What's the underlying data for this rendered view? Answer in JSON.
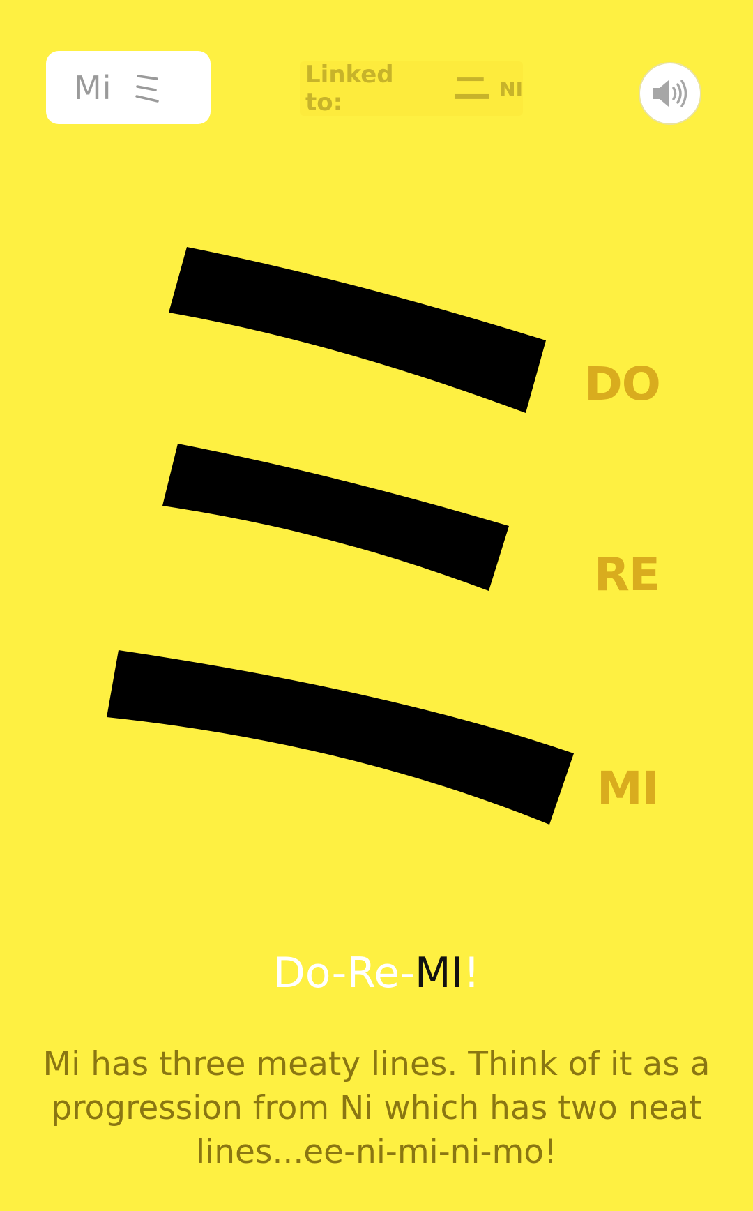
{
  "header": {
    "kana_chip": {
      "romaji": "Mi",
      "glyph_icon": "mi-katakana-icon"
    },
    "linked": {
      "label": "Linked to:",
      "glyph_icon": "ni-katakana-icon",
      "romaji": "NI"
    },
    "sound_button_icon": "speaker-icon"
  },
  "stroke_labels": [
    "DO",
    "RE",
    "MI"
  ],
  "title": {
    "part1": "Do-Re-",
    "part2": "MI",
    "part3": "!"
  },
  "description": "Mi has three meaty lines. Think of it as a progression from Ni which has two neat lines...ee-ni-mi-ni-mo!",
  "colors": {
    "background": "#fef042",
    "label_gold": "#d9ac1e",
    "description_text": "#8a7612",
    "stroke": "#000000"
  }
}
